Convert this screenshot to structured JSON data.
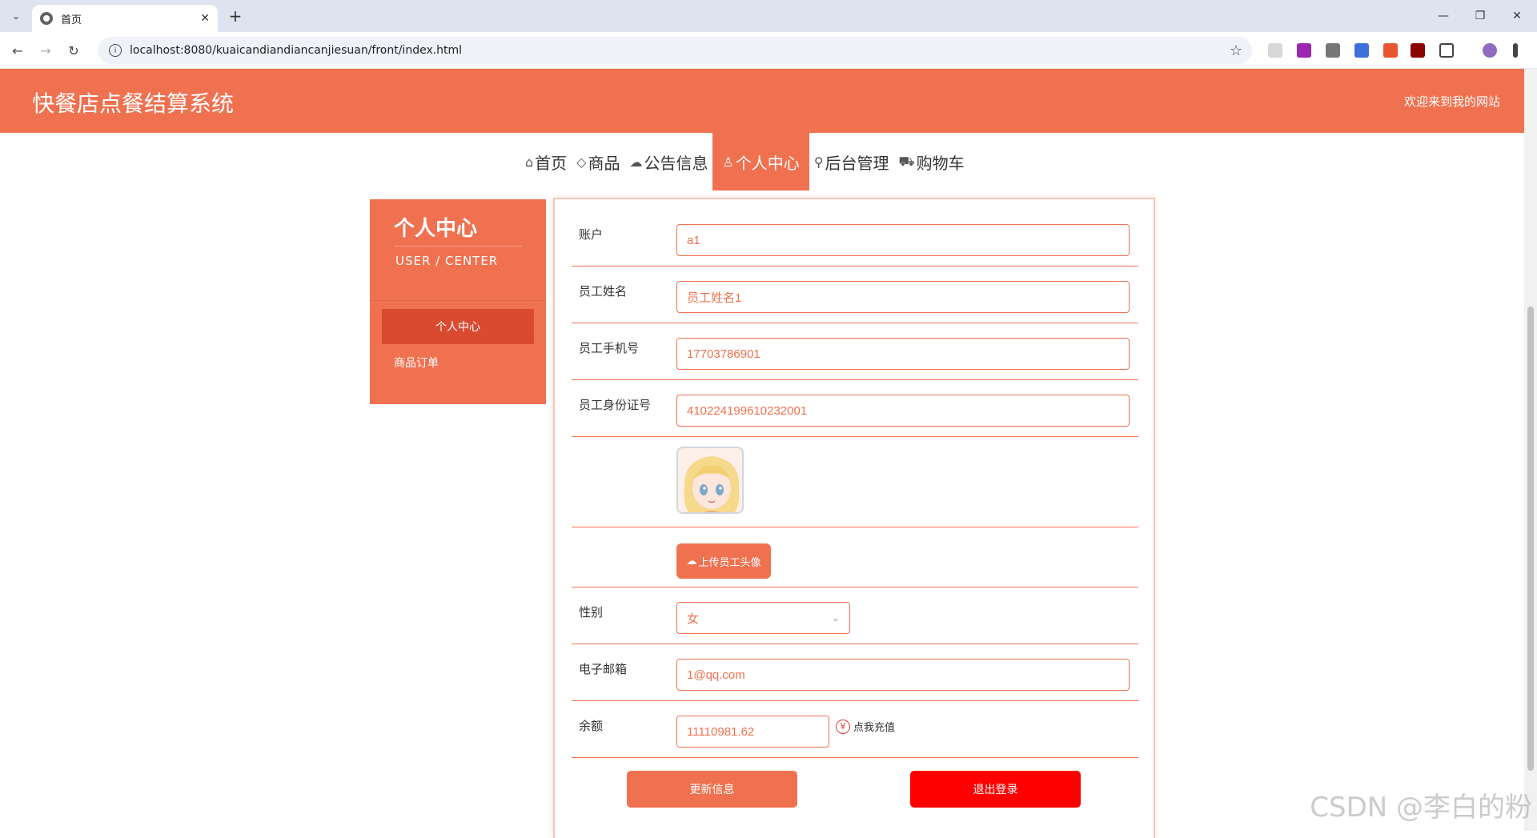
{
  "browser": {
    "tab_title": "首页",
    "url": "localhost:8080/kuaicandiandiancanjiesuan/front/index.html"
  },
  "header": {
    "site_title": "快餐店点餐结算系统",
    "welcome": "欢迎来到我的网站"
  },
  "nav": {
    "items": [
      {
        "label": "首页",
        "icon": "home-icon"
      },
      {
        "label": "商品",
        "icon": "tag-icon"
      },
      {
        "label": "公告信息",
        "icon": "cloud-icon"
      },
      {
        "label": "个人中心",
        "icon": "user-icon"
      },
      {
        "label": "后台管理",
        "icon": "link-icon"
      },
      {
        "label": "购物车",
        "icon": "cart-icon"
      }
    ],
    "active": "个人中心"
  },
  "sidebar": {
    "title": "个人中心",
    "subtitle": "USER / CENTER",
    "items": [
      {
        "label": "个人中心"
      },
      {
        "label": "商品订单"
      }
    ]
  },
  "form": {
    "account_label": "账户",
    "account_value": "a1",
    "name_label": "员工姓名",
    "name_value": "员工姓名1",
    "phone_label": "员工手机号",
    "phone_value": "17703786901",
    "idcard_label": "员工身份证号",
    "idcard_value": "410224199610232001",
    "upload_label": "上传员工头像",
    "gender_label": "性别",
    "gender_value": "女",
    "email_label": "电子邮箱",
    "email_value": "1@qq.com",
    "balance_label": "余额",
    "balance_value": "11110981.62",
    "recharge_label": "点我充值",
    "update_button": "更新信息",
    "logout_button": "退出登录"
  },
  "watermark": "CSDN @李白的粉",
  "colors": {
    "accent": "#f07150",
    "sidebar_active": "#d94a30",
    "logout": "#ff0000"
  }
}
